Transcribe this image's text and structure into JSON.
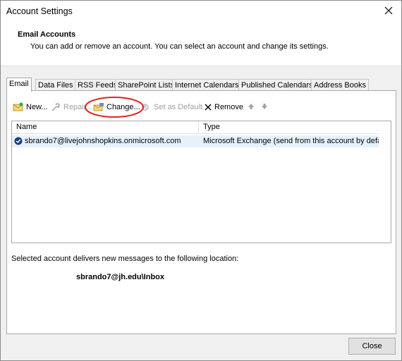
{
  "window": {
    "title": "Account Settings"
  },
  "header": {
    "title": "Email Accounts",
    "subtitle": "You can add or remove an account. You can select an account and change its settings."
  },
  "tabs": [
    {
      "label": "Email",
      "active": true
    },
    {
      "label": "Data Files"
    },
    {
      "label": "RSS Feeds"
    },
    {
      "label": "SharePoint Lists"
    },
    {
      "label": "Internet Calendars"
    },
    {
      "label": "Published Calendars"
    },
    {
      "label": "Address Books"
    }
  ],
  "toolbar": {
    "new_label": "New...",
    "repair_label": "Repair...",
    "change_label": "Change...",
    "set_default_label": "Set as Default",
    "remove_label": "Remove"
  },
  "table": {
    "columns": [
      "Name",
      "Type"
    ],
    "rows": [
      {
        "name": "sbrando7@livejohnshopkins.onmicrosoft.com",
        "type": "Microsoft Exchange (send from this account by defa..."
      }
    ]
  },
  "delivery": {
    "label": "Selected account delivers new messages to the following location:",
    "location": "sbrando7@jh.edu\\Inbox"
  },
  "footer": {
    "close_label": "Close"
  },
  "colors": {
    "annotation_circle": "#e0221b",
    "selection": "#e5f1fb"
  }
}
